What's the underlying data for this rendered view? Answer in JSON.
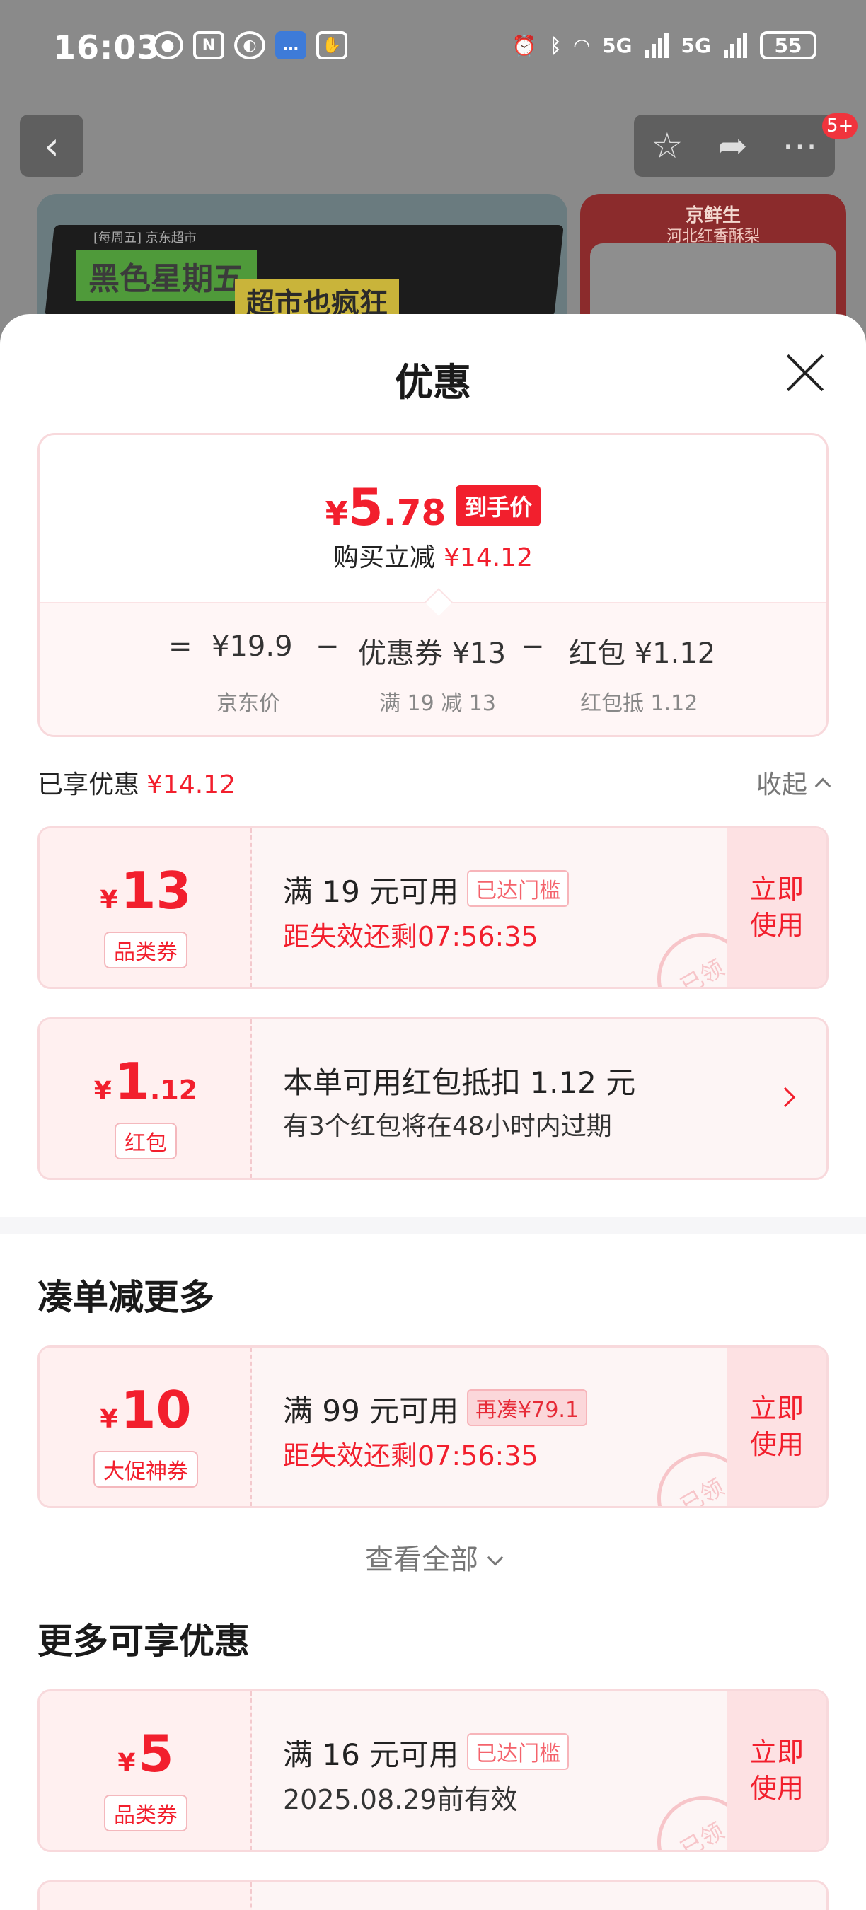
{
  "status_bar": {
    "time": "16:03",
    "battery": "55",
    "net1": "5G",
    "net2": "5G"
  },
  "nav": {
    "badge": "5+"
  },
  "banner": {
    "small_text": "[每周五] 京东超市",
    "green_text": "黑色星期五",
    "yellow_text": "超市也疯狂",
    "right_title": "京鲜生",
    "right_sub": "河北红香酥梨"
  },
  "sheet": {
    "title": "优惠"
  },
  "price_card": {
    "yen": "¥",
    "integer": "5",
    "decimal": ".78",
    "tag": "到手价",
    "reduce_label": "购买立减",
    "reduce_value": "¥14.12",
    "formula": {
      "eq": "=",
      "base_price": "¥19.9",
      "base_label": "京东价",
      "minus1": "−",
      "coupon": "优惠券 ¥13",
      "coupon_label": "满 19 减 13",
      "minus2": "−",
      "redpack": "红包 ¥1.12",
      "redpack_label": "红包抵 1.12"
    }
  },
  "enjoyed": {
    "label": "已享优惠",
    "value": "¥14.12",
    "collapse": "收起"
  },
  "coupons_enjoyed": [
    {
      "yen": "¥",
      "amount": "13",
      "decimal": "",
      "type": "品类券",
      "line1": "满 19 元可用",
      "pill": "已达门槛",
      "line2": "距失效还剩07:56:35",
      "use1": "立即",
      "use2": "使用",
      "stamp": "已领"
    },
    {
      "yen": "¥",
      "amount": "1",
      "decimal": ".12",
      "type": "红包",
      "line1": "本单可用红包抵扣 1.12 元",
      "line2": "有3个红包将在48小时内过期"
    }
  ],
  "section_more_reduce": {
    "title": "凑单减更多",
    "coupon": {
      "yen": "¥",
      "amount": "10",
      "type": "大促神券",
      "line1": "满 99 元可用",
      "pill": "再凑¥79.1",
      "line2": "距失效还剩07:56:35",
      "use1": "立即",
      "use2": "使用",
      "stamp": "已领"
    },
    "view_all": "查看全部"
  },
  "section_more_enjoy": {
    "title": "更多可享优惠",
    "coupon": {
      "yen": "¥",
      "amount": "5",
      "type": "品类券",
      "line1": "满 16 元可用",
      "pill": "已达门槛",
      "line2": "2025.08.29前有效",
      "use1": "立即",
      "use2": "使用",
      "stamp": "已领"
    }
  }
}
